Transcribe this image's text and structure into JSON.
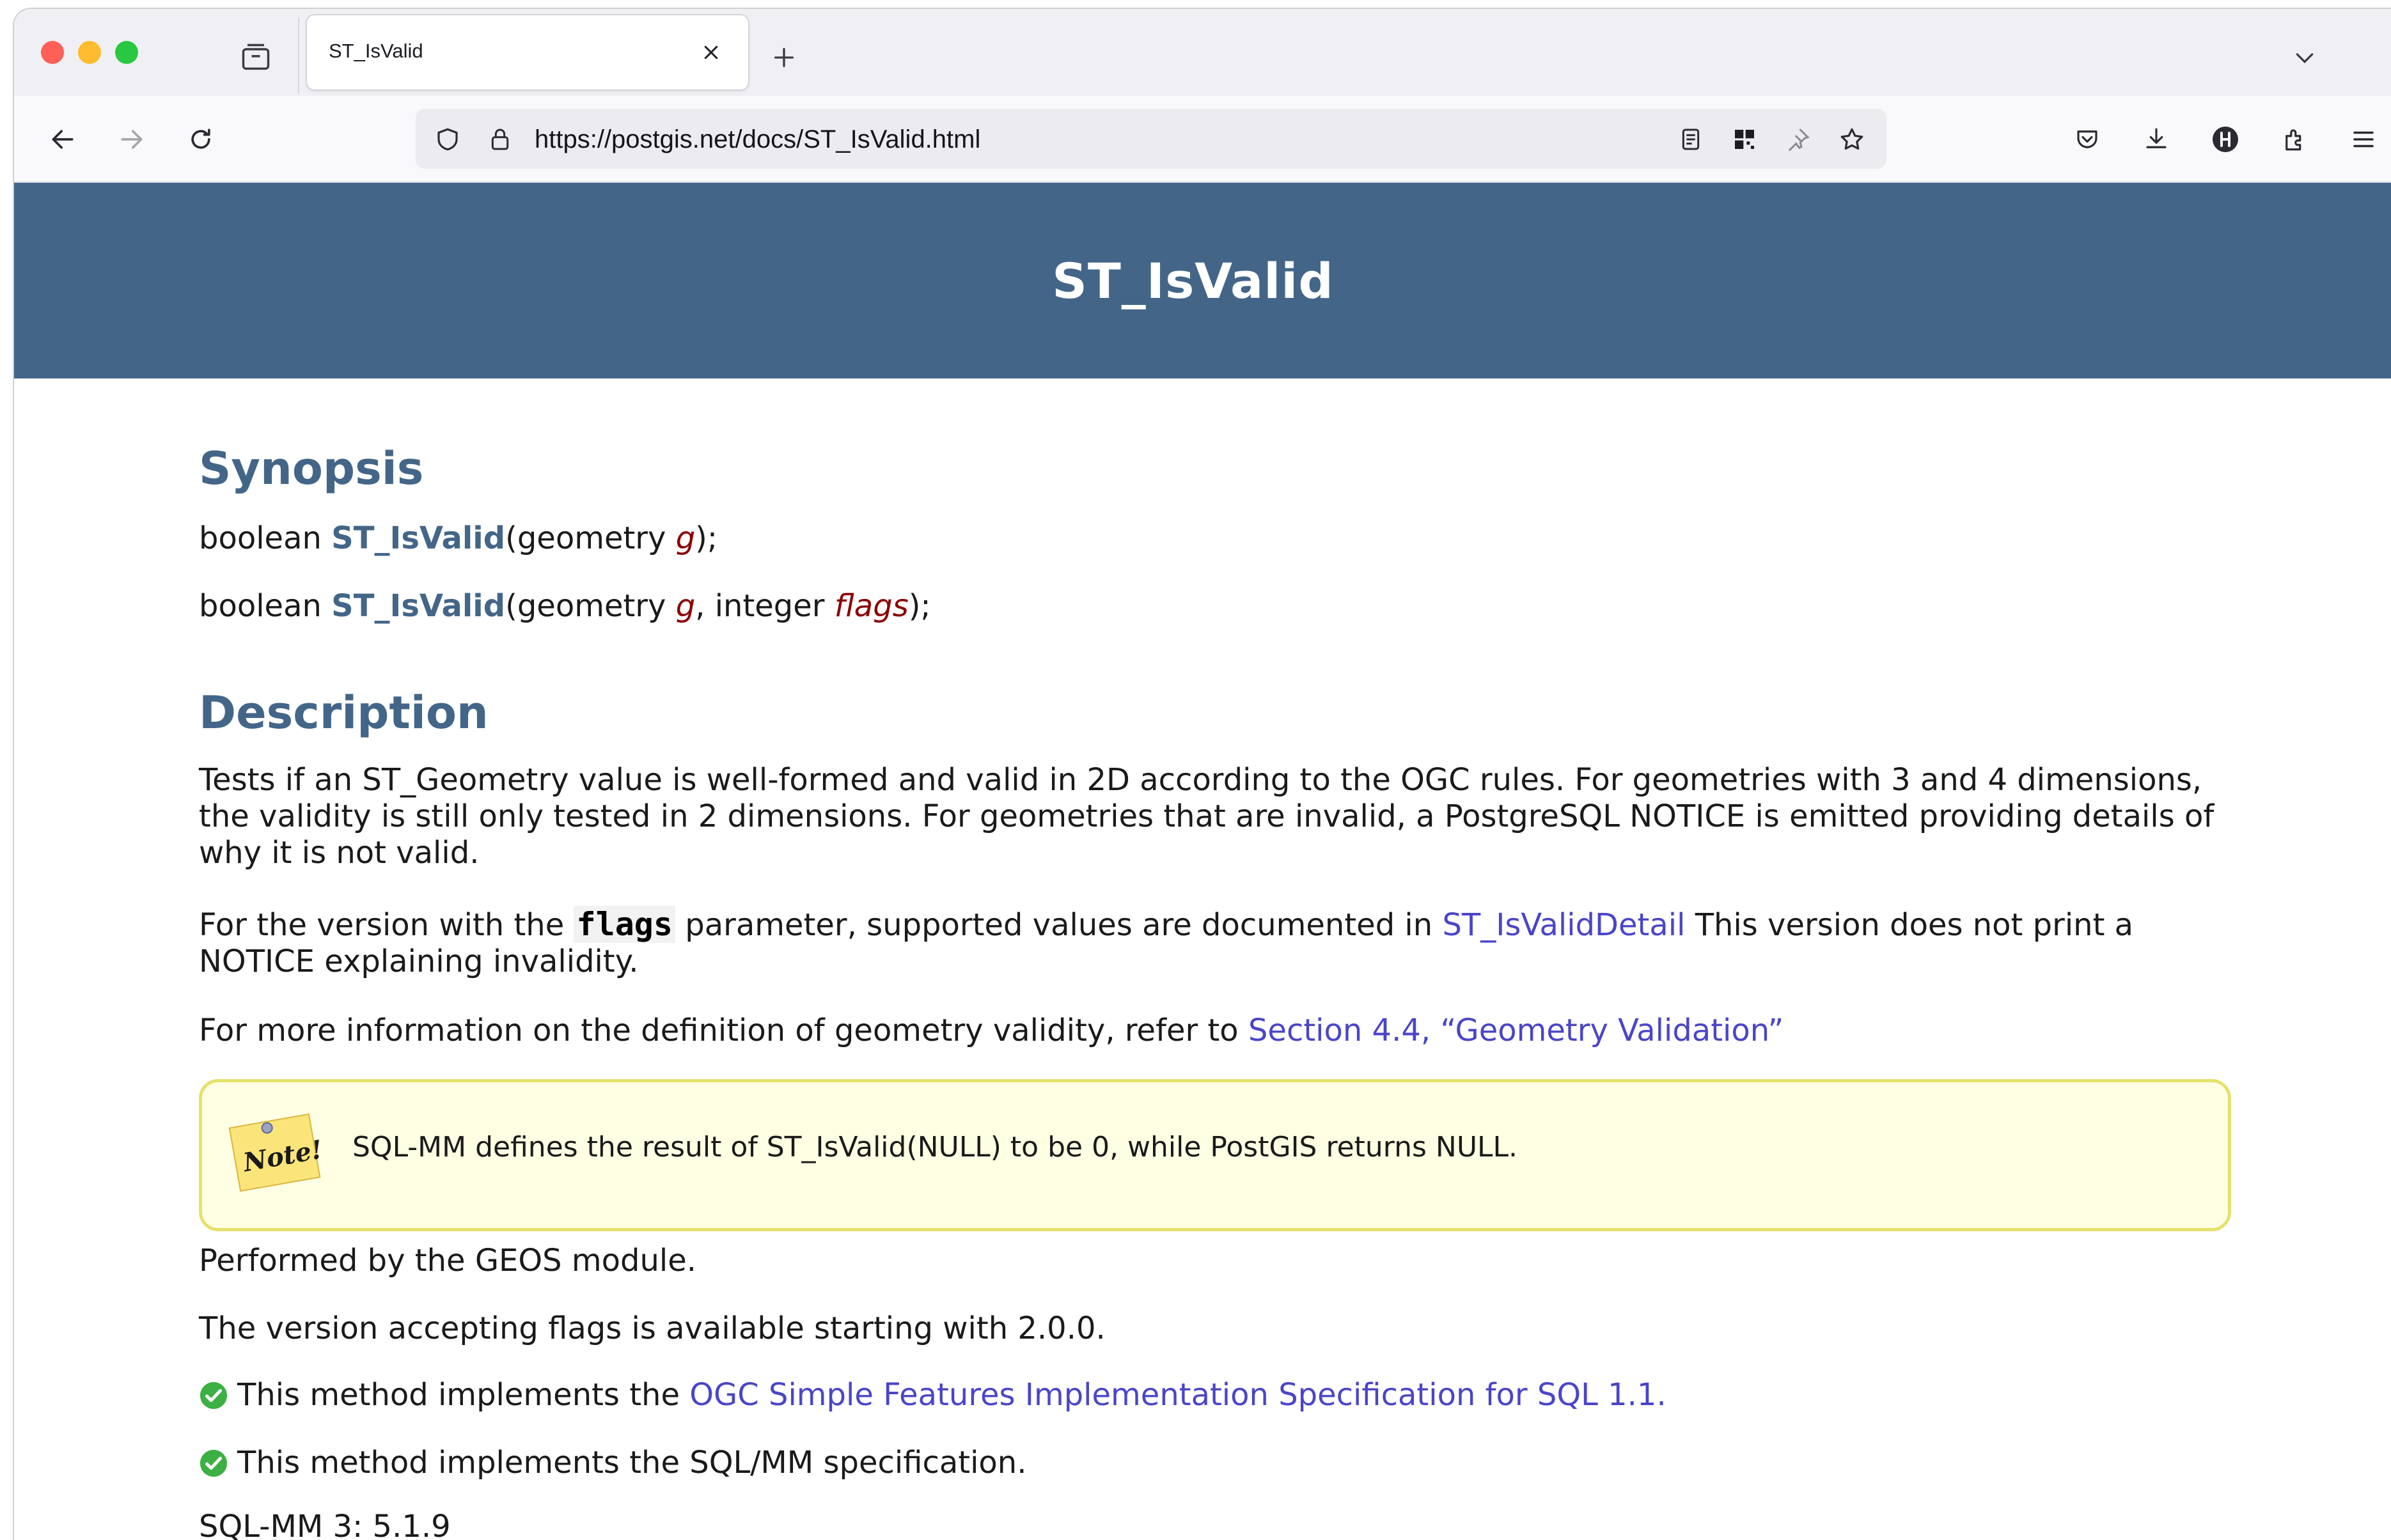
{
  "browser": {
    "tab_title": "ST_IsValid",
    "url": "https://postgis.net/docs/ST_IsValid.html"
  },
  "page": {
    "banner_title": "ST_IsValid",
    "synopsis": {
      "heading": "Synopsis",
      "sig1": {
        "ret": "boolean ",
        "func": "ST_IsValid",
        "open": "(geometry ",
        "p1": "g",
        "close": ");"
      },
      "sig2": {
        "ret": "boolean ",
        "func": "ST_IsValid",
        "open": "(geometry ",
        "p1": "g",
        "mid": ", integer ",
        "p2": "flags",
        "close": ");"
      }
    },
    "description": {
      "heading": "Description",
      "p1": "Tests if an ST_Geometry value is well-formed and valid in 2D according to the OGC rules. For geometries with 3 and 4 dimensions, the validity is still only tested in 2 dimensions. For geometries that are invalid, a PostgreSQL NOTICE is emitted providing details of why it is not valid.",
      "p2_before": "For the version with the ",
      "p2_code": "flags",
      "p2_mid": " parameter, supported values are documented in ",
      "p2_link": "ST_IsValidDetail",
      "p2_after": " This version does not print a NOTICE explaining invalidity.",
      "p3_before": "For more information on the definition of geometry validity, refer to ",
      "p3_link": "Section 4.4, “Geometry Validation”",
      "note_badge": "Note!",
      "note_text": "SQL-MM defines the result of ST_IsValid(NULL) to be 0, while PostGIS returns NULL.",
      "p4": "Performed by the GEOS module.",
      "p5": "The version accepting flags is available starting with 2.0.0.",
      "p6_before": "This method implements the ",
      "p6_link": "OGC Simple Features Implementation Specification for SQL 1.1.",
      "p7": "This method implements the SQL/MM specification.",
      "p8": "SQL-MM 3: 5.1.9"
    }
  },
  "colors": {
    "banner_bg": "#436688",
    "heading": "#436688",
    "link": "#4a45c8",
    "param": "#8b0000",
    "note_bg": "#ffffe3",
    "note_border": "#e6e16c",
    "check": "#3cb043"
  },
  "icons": [
    "sidebar-tabs-icon",
    "close-icon",
    "plus-icon",
    "chevron-down-icon",
    "back-arrow-icon",
    "forward-arrow-icon",
    "reload-icon",
    "shield-icon",
    "lock-icon",
    "reader-view-icon",
    "qr-code-icon",
    "pin-icon",
    "star-icon",
    "pocket-icon",
    "download-icon",
    "account-icon",
    "extensions-icon",
    "menu-icon",
    "check-icon"
  ]
}
